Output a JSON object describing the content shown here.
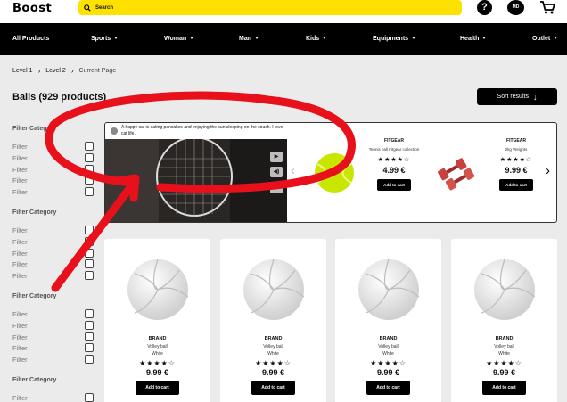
{
  "header": {
    "logo": "Boost",
    "search_label": "Search",
    "avatar_initials": "MD"
  },
  "nav": {
    "items": [
      {
        "label": "All Products"
      },
      {
        "label": "Sports"
      },
      {
        "label": "Woman"
      },
      {
        "label": "Man"
      },
      {
        "label": "Kids"
      },
      {
        "label": "Equipments"
      },
      {
        "label": "Health"
      },
      {
        "label": "Outlet"
      }
    ]
  },
  "breadcrumb": {
    "level1": "Level 1",
    "level2": "Level 2",
    "current": "Current Page"
  },
  "page": {
    "title": "Balls (929 products)",
    "sort_label": "Sort results"
  },
  "filters": {
    "group_title": "Filter Category",
    "item_label": "Filter",
    "groups": [
      {
        "items": 5
      },
      {
        "items": 5
      },
      {
        "items": 5
      },
      {
        "items": 1
      }
    ]
  },
  "carousel": {
    "video_caption": "A happy cat is eating pancakes and enjoying the sun,sleeping on the couch. I love cat life.",
    "controls": [
      "play-icon",
      "volume-icon",
      "cc-icon"
    ],
    "cc_label": "CC",
    "items": [
      {
        "brand": "FITGEAR",
        "name": "Tennis ball Fitgear collection",
        "rating": 3.5,
        "stars": "★★★★☆",
        "price": "4.99 €",
        "button": "Add to cart"
      },
      {
        "brand": "FITGEAR",
        "name": "2kg Weights",
        "rating": 3.5,
        "stars": "★★★★☆",
        "price": "9.99 €",
        "button": "Add to cart"
      }
    ]
  },
  "products": [
    {
      "brand": "BRAND",
      "name": "Volley ball",
      "color": "White",
      "rating": 3.5,
      "stars": "★★★★☆",
      "price": "9.99 €",
      "button": "Add to cart"
    },
    {
      "brand": "BRAND",
      "name": "Volley ball",
      "color": "White",
      "rating": 3.5,
      "stars": "★★★★☆",
      "price": "9.99 €",
      "button": "Add to cart"
    },
    {
      "brand": "BRAND",
      "name": "Volley ball",
      "color": "White",
      "rating": 3.5,
      "stars": "★★★★☆",
      "price": "9.99 €",
      "button": "Add to cart"
    },
    {
      "brand": "BRAND",
      "name": "Volley ball",
      "color": "White",
      "rating": 3.5,
      "stars": "★★★★☆",
      "price": "9.99 €",
      "button": "Add to cart"
    }
  ],
  "colors": {
    "accent": "#ffe100",
    "nav_bg": "#000000",
    "annotation": "#e8101a"
  }
}
